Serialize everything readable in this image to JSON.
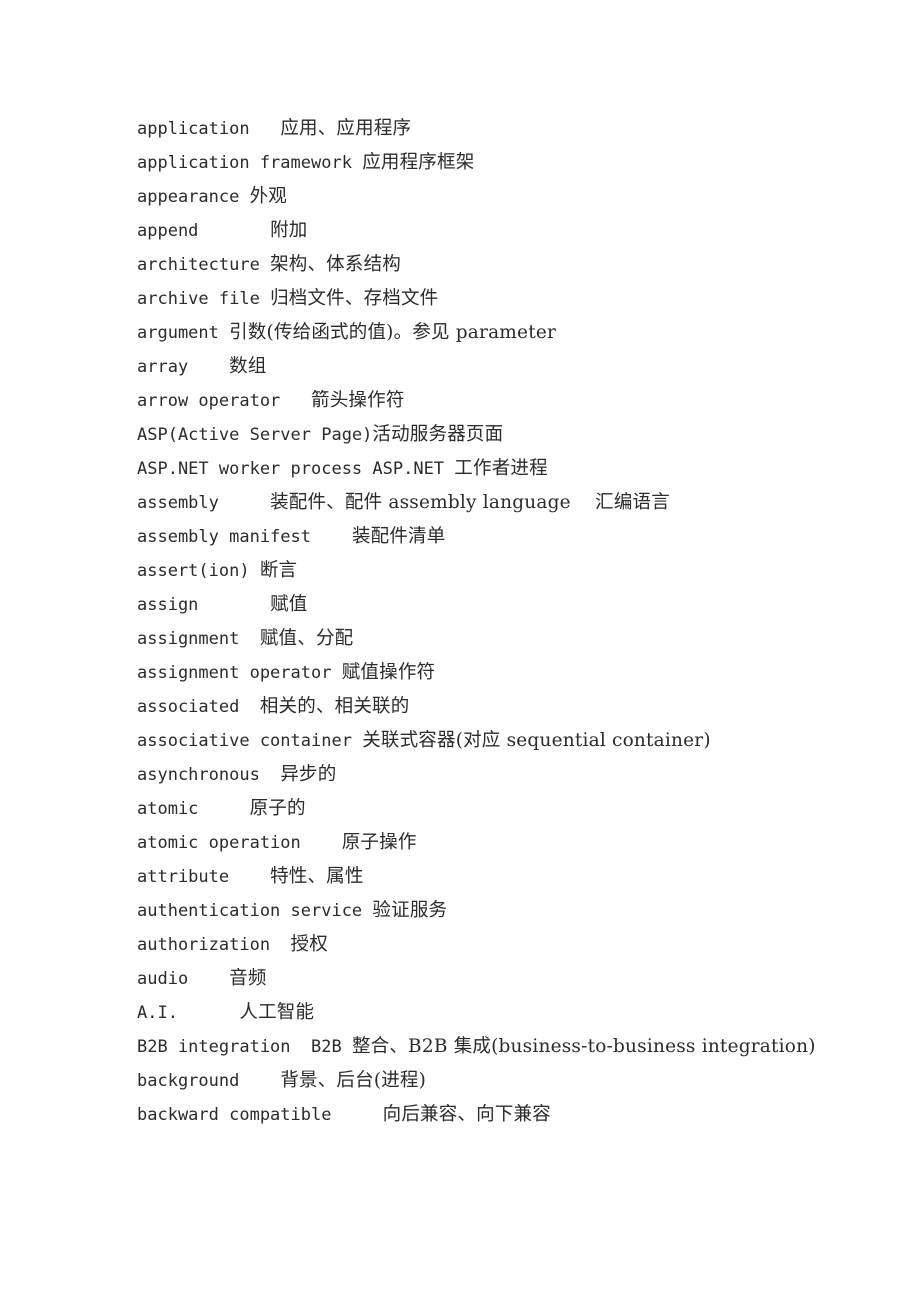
{
  "document": {
    "type": "glossary-page",
    "language_pair": "English-Chinese",
    "background_color": "#ffffff",
    "text_color": "#2b2b2b",
    "entries": [
      {
        "term": "application",
        "gap": "   ",
        "translation": "应用、应用程序"
      },
      {
        "term": "application framework",
        "gap": " ",
        "translation": "应用程序框架"
      },
      {
        "term": "appearance",
        "gap": " ",
        "translation": "外观"
      },
      {
        "term": "append",
        "gap": "       ",
        "translation": "附加"
      },
      {
        "term": "architecture",
        "gap": " ",
        "translation": "架构、体系结构"
      },
      {
        "term": "archive file",
        "gap": " ",
        "translation": "归档文件、存档文件"
      },
      {
        "term": "argument",
        "gap": " ",
        "translation": "引数(传给函式的值)。参见 parameter"
      },
      {
        "term": "array",
        "gap": "    ",
        "translation": "数组"
      },
      {
        "term": "arrow operator",
        "gap": "   ",
        "translation": "箭头操作符"
      },
      {
        "term": "ASP(Active Server Page)",
        "gap": "",
        "translation": "活动服务器页面"
      },
      {
        "term": "ASP.NET worker process ASP.NET",
        "gap": " ",
        "translation": "工作者进程"
      },
      {
        "term": "assembly",
        "gap": "     ",
        "translation": "装配件、配件 assembly language    汇编语言"
      },
      {
        "term": "assembly manifest",
        "gap": "    ",
        "translation": "装配件清单"
      },
      {
        "term": "assert(ion)",
        "gap": " ",
        "translation": "断言"
      },
      {
        "term": "assign",
        "gap": "       ",
        "translation": "赋值"
      },
      {
        "term": "assignment",
        "gap": "  ",
        "translation": "赋值、分配"
      },
      {
        "term": "assignment operator",
        "gap": " ",
        "translation": "赋值操作符"
      },
      {
        "term": "associated",
        "gap": "  ",
        "translation": "相关的、相关联的"
      },
      {
        "term": "associative container",
        "gap": " ",
        "translation": "关联式容器(对应 sequential container)"
      },
      {
        "term": "asynchronous",
        "gap": "  ",
        "translation": "异步的"
      },
      {
        "term": "atomic",
        "gap": "     ",
        "translation": "原子的"
      },
      {
        "term": "atomic operation",
        "gap": "    ",
        "translation": "原子操作"
      },
      {
        "term": "attribute",
        "gap": "    ",
        "translation": "特性、属性"
      },
      {
        "term": "authentication service",
        "gap": " ",
        "translation": "验证服务"
      },
      {
        "term": "authorization",
        "gap": "  ",
        "translation": "授权"
      },
      {
        "term": "audio",
        "gap": "    ",
        "translation": "音频"
      },
      {
        "term": "A.I.",
        "gap": "      ",
        "translation": "人工智能"
      },
      {
        "term": "B2B integration  B2B",
        "gap": " ",
        "translation": "整合、B2B 集成(business-to-business integration)"
      },
      {
        "term": "background",
        "gap": "    ",
        "translation": "背景、后台(进程)"
      },
      {
        "term": "backward compatible",
        "gap": "     ",
        "translation": "向后兼容、向下兼容"
      }
    ]
  }
}
